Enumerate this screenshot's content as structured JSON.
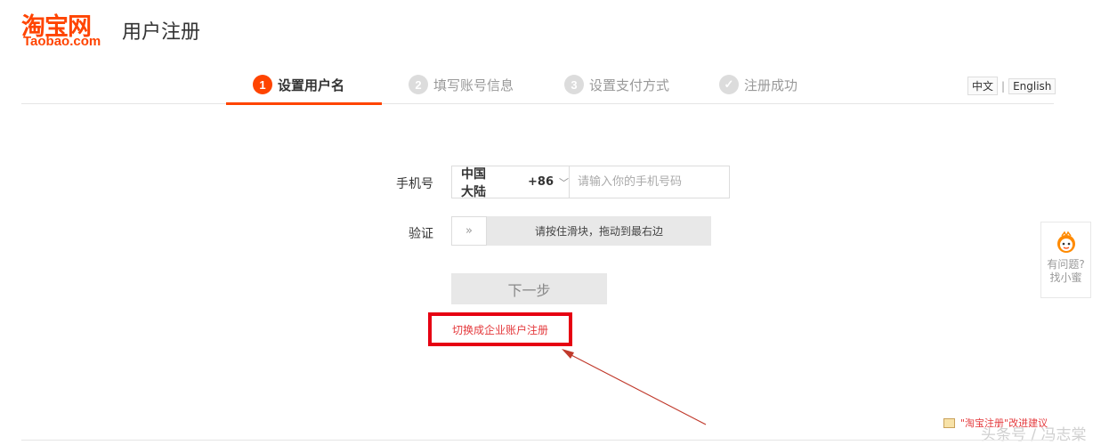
{
  "header": {
    "logo_cn": "淘宝网",
    "logo_en": "Taobao.com",
    "title": "用户注册"
  },
  "steps": [
    {
      "num": "1",
      "label": "设置用户名",
      "active": true
    },
    {
      "num": "2",
      "label": "填写账号信息",
      "active": false
    },
    {
      "num": "3",
      "label": "设置支付方式",
      "active": false
    },
    {
      "num": "✓",
      "label": "注册成功",
      "active": false
    }
  ],
  "language": {
    "zh": "中文",
    "separator": "|",
    "en": "English"
  },
  "form": {
    "phone_label": "手机号",
    "country": "中国大陆",
    "country_code": "+86",
    "phone_placeholder": "请输入你的手机号码",
    "verify_label": "验证",
    "slider_handle": "»",
    "slider_text": "请按住滑块，拖动到最右边",
    "next_label": "下一步",
    "enterprise_link": "切换成企业账户注册"
  },
  "help": {
    "line1": "有问题?",
    "line2": "找小蜜"
  },
  "feedback": "\"淘宝注册\"改进建议",
  "watermark": "头条号 / 冯志棠",
  "colors": {
    "brand": "#ff4400",
    "highlight_box": "#e60012",
    "link": "#e4393c"
  }
}
